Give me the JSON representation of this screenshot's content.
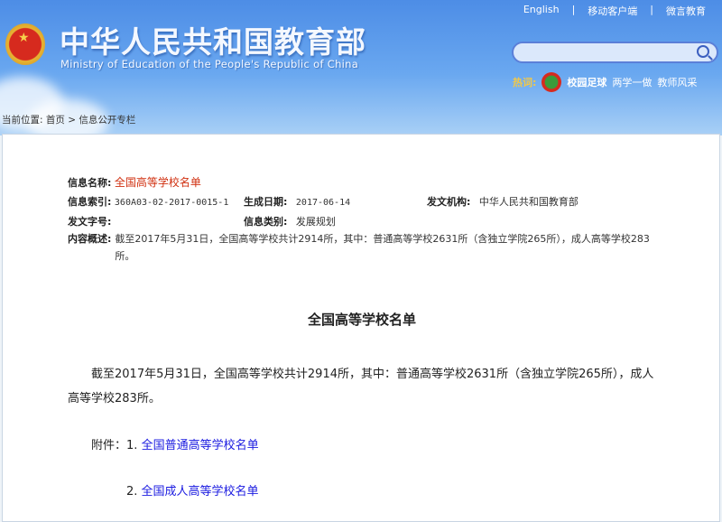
{
  "header": {
    "title_cn": "中华人民共和国教育部",
    "title_en": "Ministry of Education of the People's Republic of China",
    "top_links": [
      "English",
      "|",
      "移动客户端",
      "|",
      "微言教育"
    ],
    "search": {
      "placeholder": "",
      "icon": "search-icon"
    },
    "hot": {
      "label": "热词:",
      "items": [
        "校园足球",
        "两学一做",
        "教师风采"
      ]
    }
  },
  "breadcrumb": {
    "prefix": "当前位置:",
    "items": [
      "首页",
      ">",
      "信息公开专栏"
    ]
  },
  "meta": {
    "name_label": "信息名称:",
    "name_value": "全国高等学校名单",
    "index_label": "信息索引:",
    "index_value": "360A03-02-2017-0015-1",
    "date_label": "生成日期:",
    "date_value": "2017-06-14",
    "org_label": "发文机构:",
    "org_value": "中华人民共和国教育部",
    "docno_label": "发文字号:",
    "docno_value": "",
    "category_label": "信息类别:",
    "category_value": "发展规划",
    "summary_label": "内容概述:",
    "summary_value": "截至2017年5月31日，全国高等学校共计2914所，其中：普通高等学校2631所（含独立学院265所），成人高等学校283所。"
  },
  "article": {
    "title": "全国高等学校名单",
    "body": "截至2017年5月31日，全国高等学校共计2914所，其中：普通高等学校2631所（含独立学院265所），成人高等学校283所。",
    "attach_prefix": "附件：",
    "attachments": [
      {
        "num": "1.",
        "label": "全国普通高等学校名单"
      },
      {
        "num": "2.",
        "label": "全国成人高等学校名单"
      }
    ]
  },
  "colors": {
    "header_blue": "#4d8de6",
    "title_red": "#d03010",
    "link_blue": "#1a1ae0"
  }
}
